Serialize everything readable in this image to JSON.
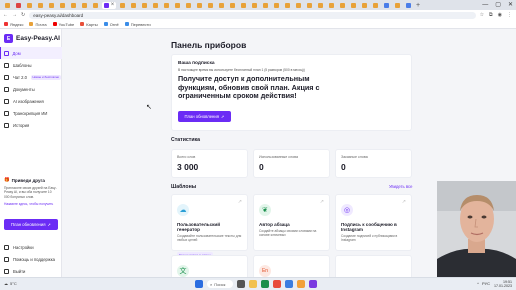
{
  "browser": {
    "url": "easy-peasy.ai/dashboard",
    "bookmarks": [
      "Яндекс",
      "Почта",
      "YouTube",
      "Карты",
      "Огнё",
      "Перевести"
    ],
    "tab_colors": [
      "#e8a23a",
      "#d44",
      "#e8a23a",
      "#e8a23a",
      "#e8a23a",
      "#e8a23a",
      "#e8a23a",
      "#e8a23a",
      "#e8a23a",
      "#6b2cf5",
      "#e8a23a",
      "#e8a23a",
      "#e8a23a",
      "#e8a23a",
      "#e8a23a",
      "#e8a23a",
      "#e8a23a",
      "#e8a23a",
      "#e8a23a",
      "#e8a23a",
      "#e8a23a",
      "#e8a23a",
      "#e8a23a",
      "#e8a23a",
      "#e8a23a",
      "#e8a23a",
      "#e8a23a",
      "#e8a23a",
      "#e8a23a",
      "#e8a23a",
      "#e8a23a",
      "#e8a23a",
      "#e8a23a",
      "#e8a23a",
      "#4a7de8",
      "#e8a23a",
      "#4a7de8"
    ]
  },
  "sidebar": {
    "logo": "Easy-Peasy.AI",
    "logo_mark": "E",
    "items": [
      {
        "label": "Дом",
        "active": true
      },
      {
        "label": "Шаблоны"
      },
      {
        "label": "Чат 2.0",
        "badge": "Новое и бесплатно"
      },
      {
        "label": "Документы"
      },
      {
        "label": "AI изображения"
      },
      {
        "label": "Транскрипция ИИ"
      },
      {
        "label": "История"
      }
    ],
    "friend": {
      "title": "Приведи друга",
      "text": "Пригласите своих друзей на Easy-Peasy AI, и вы оба получите 10 000 бонусных слов.",
      "link_text": "Нажмите здесь, чтобы получить"
    },
    "upgrade_button": "План обновления",
    "bottom_items": [
      {
        "label": "Настройки"
      },
      {
        "label": "Помощь и поддержка"
      },
      {
        "label": "Выйти"
      }
    ]
  },
  "main": {
    "page_title": "Панель приборов",
    "promo": {
      "subtitle": "Ваша подписка",
      "note": "В настоящее время вы используете бесплатный план 1 (5 разворов (500 в месяц))",
      "headline": "Получите доступ к дополнительным функциям, обновив свой план. Акция с ограниченным сроком действия!",
      "button": "План обновления"
    },
    "stats_title": "Статистика",
    "stats": [
      {
        "label": "Всего слов",
        "value": "3 000"
      },
      {
        "label": "Использованные слова",
        "value": "0"
      },
      {
        "label": "Заказные слова",
        "value": "0"
      }
    ],
    "templates_title": "Шаблоны",
    "see_all": "Увидеть все",
    "templates": [
      {
        "title": "Пользовательский генератор",
        "desc": "Создавайте пользовательские тексты для любых целей",
        "tag": "Только платные планы",
        "icon": "cloud-icon",
        "color": "#2a9fd6"
      },
      {
        "title": "Автор абзаца",
        "desc": "Создайте абзацы своими словами на основе ключевых",
        "icon": "leaf-icon",
        "color": "#1a8f4c"
      },
      {
        "title": "Подпись к сообщению в Instagram",
        "desc": "Создание подписей к публикациям в Instagram",
        "icon": "instagram-icon",
        "color": "#6b2cf5"
      }
    ]
  },
  "taskbar": {
    "weather": "5°C",
    "search": "Поиск",
    "time": "19:51",
    "date": "17.01.2023",
    "lang": "РУС"
  }
}
